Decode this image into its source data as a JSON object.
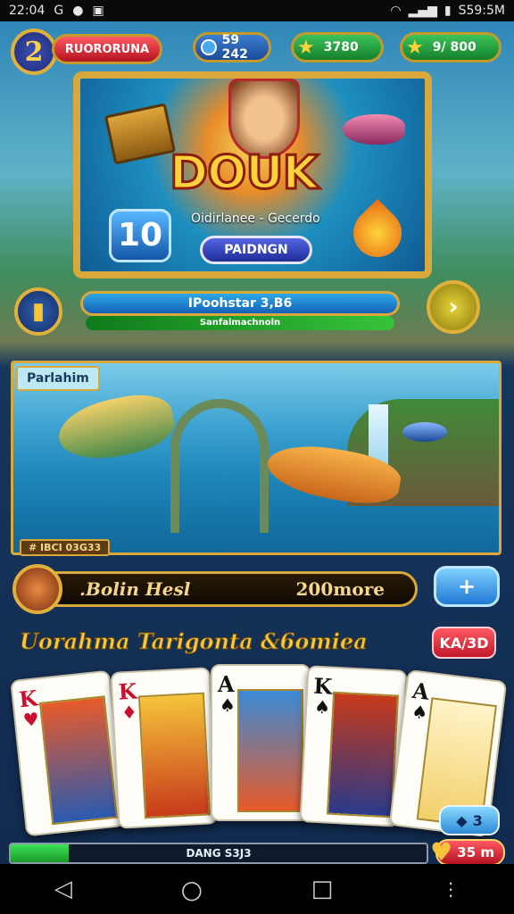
{
  "status_bar": {
    "time": "22:04",
    "left_icons": [
      "G",
      "●",
      "▣"
    ],
    "right_text": "S59:5M"
  },
  "header": {
    "level": "2",
    "player_name": "RUORORUNA",
    "coins": "59 242",
    "stars": "3780",
    "gems": "9/ 800"
  },
  "hero": {
    "logo": "DOUK",
    "subtitle": "Oidirlanee - Gecerdo",
    "button": "PAIDNGN",
    "counter": "10"
  },
  "progress": {
    "label": "IPoohstar 3,B6",
    "sub_label": "Sanfalmachnoln"
  },
  "scene": {
    "tag": "Parlahim",
    "rank": "# IBCI 03G33"
  },
  "score_bar": {
    "left_text": ".Bolin Hesl",
    "right_text": "200more",
    "plus_label": "+"
  },
  "section": {
    "title": "Uorahma Tarigonta &6omiea",
    "red_button": "KA/3D"
  },
  "cards": [
    {
      "rank": "K",
      "suit": "♥",
      "color": "#c8102e"
    },
    {
      "rank": "K",
      "suit": "♦",
      "color": "#c8102e"
    },
    {
      "rank": "A",
      "suit": "♠",
      "color": "#111111"
    },
    {
      "rank": "K",
      "suit": "♠",
      "color": "#111111"
    },
    {
      "rank": "A",
      "suit": "♠",
      "color": "#111111"
    }
  ],
  "bottom": {
    "bar_label": "DANG S3J3",
    "bar_fill": 0.14,
    "gem_count": "3",
    "timer": "35 m"
  },
  "nav": {
    "back": "◁",
    "home": "○",
    "recent": "□",
    "more": "⋮"
  }
}
